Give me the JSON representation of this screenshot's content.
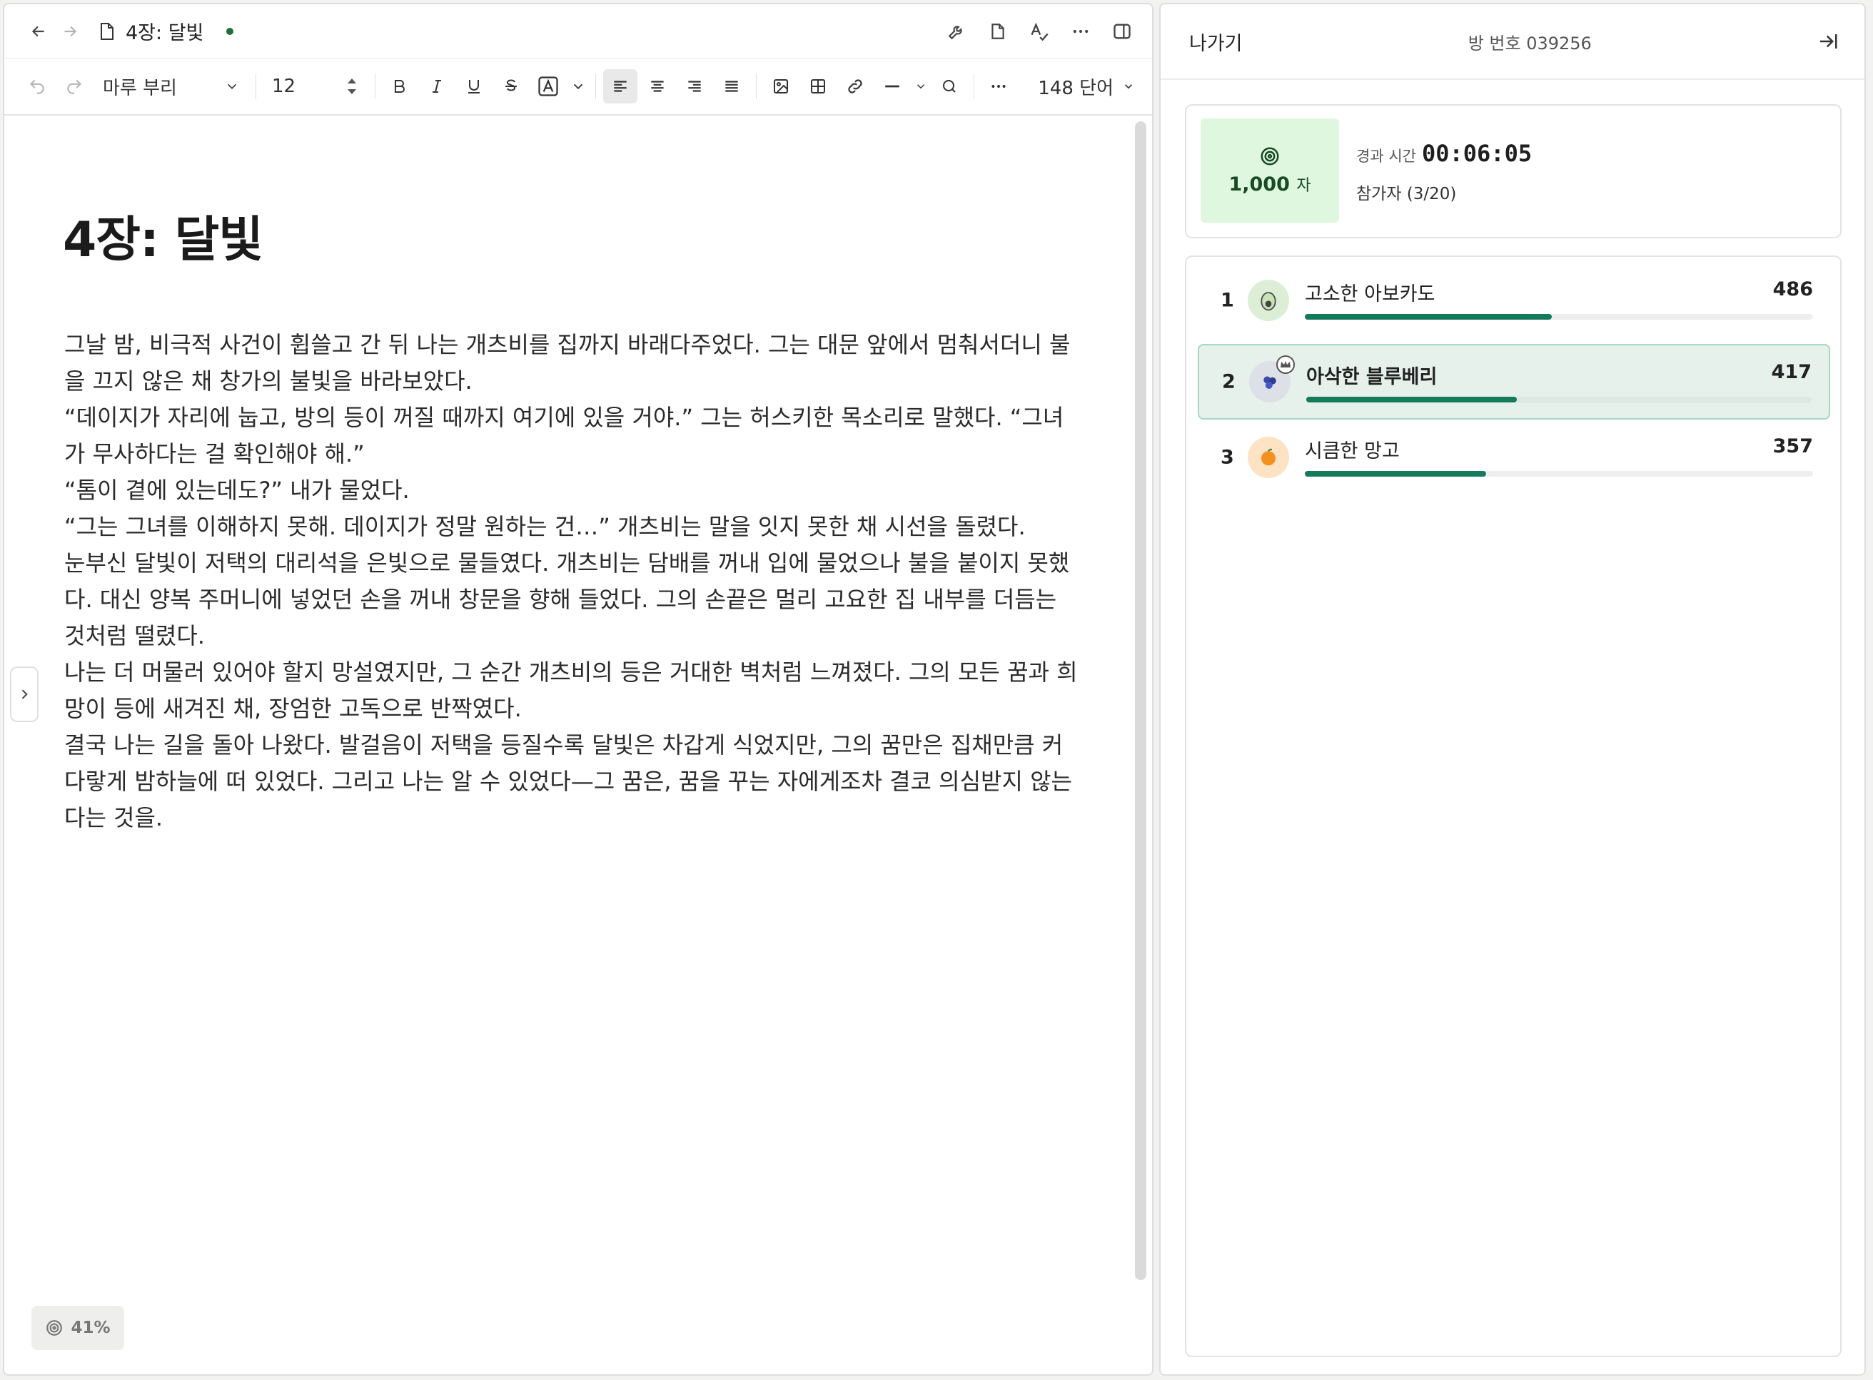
{
  "editor": {
    "doc_title": "4장: 달빛",
    "font_family": "마루 부리",
    "font_size": "12",
    "word_count": "148 단어",
    "heading": "4장: 달빛",
    "paragraphs": [
      "그날 밤, 비극적 사건이 휩쓸고 간 뒤 나는 개츠비를 집까지 바래다주었다. 그는 대문 앞에서 멈춰서더니 불을 끄지 않은 채 창가의 불빛을 바라보았다.",
      "“데이지가 자리에 눕고, 방의 등이 꺼질 때까지 여기에 있을 거야.” 그는 허스키한 목소리로 말했다. “그녀가 무사하다는 걸 확인해야 해.”",
      "“톰이 곁에 있는데도?” 내가 물었다.",
      "“그는 그녀를 이해하지 못해. 데이지가 정말 원하는 건…” 개츠비는 말을 잇지 못한 채 시선을 돌렸다.",
      "눈부신 달빛이 저택의 대리석을 은빛으로 물들였다. 개츠비는 담배를 꺼내 입에 물었으나 불을 붙이지 못했다. 대신 양복 주머니에 넣었던 손을 꺼내 창문을 향해 들었다. 그의 손끝은 멀리 고요한 집 내부를 더듬는 것처럼 떨렸다.",
      "나는 더 머물러 있어야 할지 망설였지만, 그 순간 개츠비의 등은 거대한 벽처럼 느껴졌다. 그의 모든 꿈과 희망이 등에 새겨진 채, 장엄한 고독으로 반짝였다.",
      "결국 나는 길을 돌아 나왔다. 발걸음이 저택을 등질수록 달빛은 차갑게 식었지만, 그의 꿈만은 집채만큼 커다랗게 밤하늘에 떠 있었다. 그리고 나는 알 수 있었다—그 꿈은, 꿈을 꾸는 자에게조차 결코 의심받지 않는다는 것을."
    ],
    "progress_percent": "41%",
    "saved_indicator_color": "#1f6f3a"
  },
  "side": {
    "exit_label": "나가기",
    "room_number": "방 번호 039256",
    "goal_value": "1,000",
    "goal_unit": "자",
    "elapsed_label": "경과 시간",
    "elapsed_time": "00:06:05",
    "participants": "참가자 (3/20)",
    "leaderboard": [
      {
        "rank": "1",
        "name": "고소한 아보카도",
        "score": "486",
        "progress": 0.486,
        "icon": "avocado-icon"
      },
      {
        "rank": "2",
        "name": "아삭한 블루베리",
        "score": "417",
        "progress": 0.417,
        "icon": "blueberry-icon",
        "is_me": true
      },
      {
        "rank": "3",
        "name": "시큼한 망고",
        "score": "357",
        "progress": 0.357,
        "icon": "mango-icon"
      }
    ],
    "accent_color": "#157a5c"
  }
}
